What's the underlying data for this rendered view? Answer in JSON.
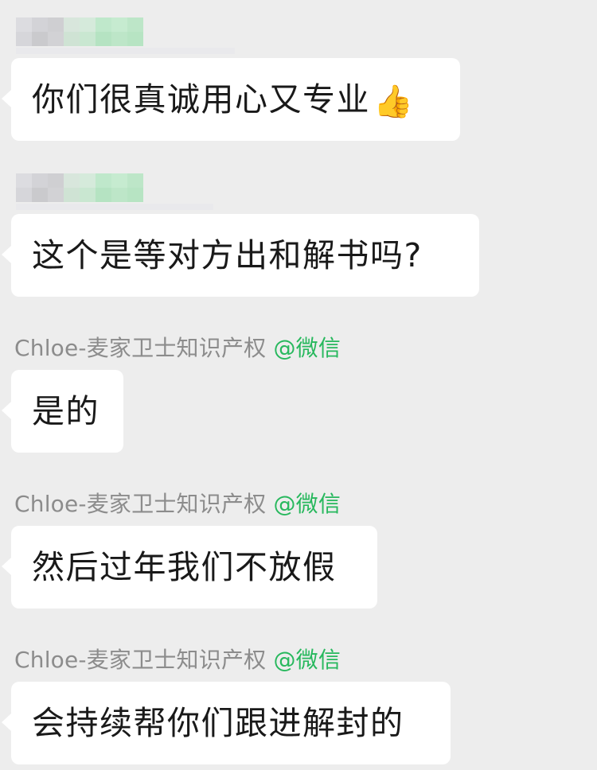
{
  "messages": [
    {
      "sender_redacted": true,
      "text": "你们很真诚用心又专业",
      "emoji": "👍",
      "emoji_icon": "thumbs-up-icon"
    },
    {
      "sender_redacted": true,
      "text": "这个是等对方出和解书吗?"
    },
    {
      "sender_name": "Chloe-麦家卫士知识产权",
      "sender_via": "@微信",
      "text": "是的"
    },
    {
      "sender_name": "Chloe-麦家卫士知识产权",
      "sender_via": "@微信",
      "text": "然后过年我们不放假"
    },
    {
      "sender_name": "Chloe-麦家卫士知识产权",
      "sender_via": "@微信",
      "text": "会持续帮你们跟进解封的"
    }
  ],
  "colors": {
    "background": "#ededed",
    "bubble": "#ffffff",
    "sender_name": "#8c8c8c",
    "sender_via": "#27b85d",
    "text": "#191919"
  }
}
